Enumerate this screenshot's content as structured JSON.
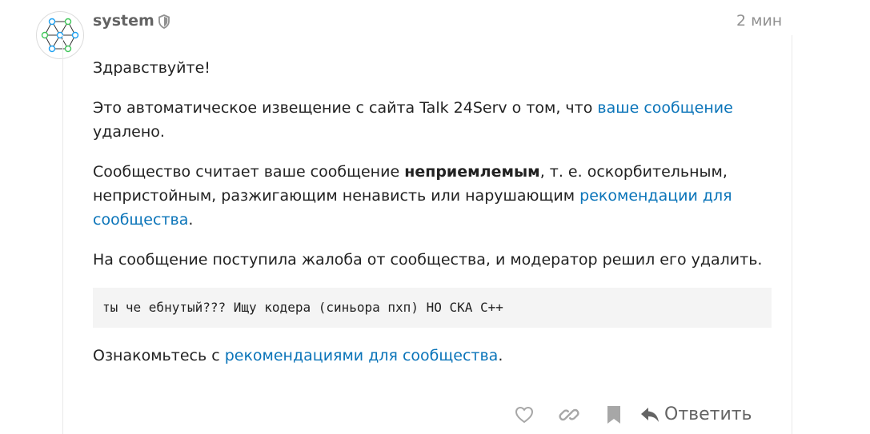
{
  "post": {
    "username": "system",
    "date": "2 мин",
    "greeting": "Здравствуйте!",
    "notice_prefix": "Это автоматическое извещение с сайта Talk 24Serv о том, что ",
    "notice_link": "ваше сообщение",
    "notice_suffix": " удалено.",
    "community_prefix": "Сообщество считает ваше сообщение ",
    "community_bold": "неприемлемым",
    "community_middle": ", т. е. оскорбительным, непристойным, разжигающим ненависть или нарушающим ",
    "community_link": "рекомендации для сообщества",
    "community_suffix": ".",
    "moderator_text": "На сообщение поступила жалоба от сообщества, и модератор решил его удалить.",
    "quoted_message": "ты че ебнутый??? Ищу кодера (синьора пхп) НО СКА С++",
    "guidelines_prefix": "Ознакомьтесь с ",
    "guidelines_link": "рекомендациями для сообщества",
    "guidelines_suffix": "."
  },
  "actions": {
    "like_icon": "heart-icon",
    "link_icon": "link-icon",
    "bookmark_icon": "bookmark-icon",
    "reply_icon": "reply-arrow-icon",
    "reply_label": "Ответить"
  },
  "colors": {
    "link": "#0a74b9",
    "muted": "#919191",
    "username": "#646464",
    "quote_bg": "#f4f4f4",
    "avatar_blue": "#1ea1f1",
    "avatar_green": "#41c65a"
  }
}
